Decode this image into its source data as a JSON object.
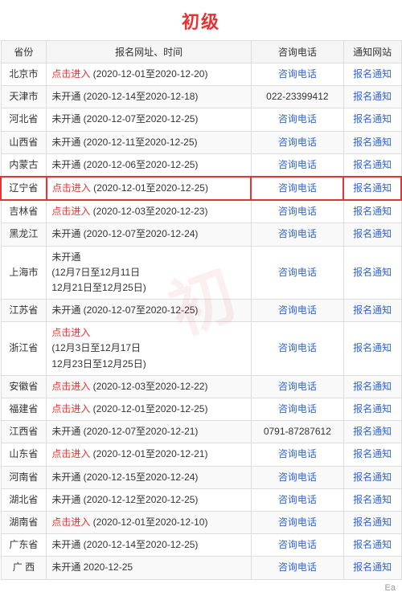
{
  "title": "初级",
  "watermark": "初",
  "footer_text": "Ea",
  "columns": [
    "省份",
    "报名网址、时间",
    "咨询电话",
    "通知网站"
  ],
  "rows": [
    {
      "province": "北京市",
      "registration": "点击进入  (2020-12-01至2020-12-20)",
      "registration_link": true,
      "phone": "",
      "phone_link": "咨询电话",
      "notice_link": "报名通知",
      "highlight": false
    },
    {
      "province": "天津市",
      "registration": "未开通  (2020-12-14至2020-12-18)",
      "registration_link": false,
      "phone": "022-23399412",
      "phone_link": "",
      "notice_link": "报名通知",
      "highlight": false
    },
    {
      "province": "河北省",
      "registration": "未开通  (2020-12-07至2020-12-25)",
      "registration_link": false,
      "phone": "",
      "phone_link": "咨询电话",
      "notice_link": "报名通知",
      "highlight": false
    },
    {
      "province": "山西省",
      "registration": "未开通  (2020-12-11至2020-12-25)",
      "registration_link": false,
      "phone": "",
      "phone_link": "咨询电话",
      "notice_link": "报名通知",
      "highlight": false
    },
    {
      "province": "内蒙古",
      "registration": "未开通  (2020-12-06至2020-12-25)",
      "registration_link": false,
      "phone": "",
      "phone_link": "咨询电话",
      "notice_link": "报名通知",
      "highlight": false
    },
    {
      "province": "辽宁省",
      "registration": "点击进入  (2020-12-01至2020-12-25)",
      "registration_link": true,
      "phone": "",
      "phone_link": "咨询电话",
      "notice_link": "报名通知",
      "highlight": true
    },
    {
      "province": "吉林省",
      "registration": "点击进入  (2020-12-03至2020-12-23)",
      "registration_link": true,
      "phone": "",
      "phone_link": "咨询电话",
      "notice_link": "报名通知",
      "highlight": false
    },
    {
      "province": "黑龙江",
      "registration": "未开通  (2020-12-07至2020-12-24)",
      "registration_link": false,
      "phone": "",
      "phone_link": "咨询电话",
      "notice_link": "报名通知",
      "highlight": false
    },
    {
      "province": "上海市",
      "registration": "未开通\n(12月7日至12月11日\n12月21日至12月25日)",
      "registration_link": false,
      "phone": "",
      "phone_link": "咨询电话",
      "notice_link": "报名通知",
      "highlight": false
    },
    {
      "province": "江苏省",
      "registration": "未开通  (2020-12-07至2020-12-25)",
      "registration_link": false,
      "phone": "",
      "phone_link": "咨询电话",
      "notice_link": "报名通知",
      "highlight": false
    },
    {
      "province": "浙江省",
      "registration": "点击进入\n(12月3日至12月17日\n12月23日至12月25日)",
      "registration_link": true,
      "phone": "",
      "phone_link": "咨询电话",
      "notice_link": "报名通知",
      "highlight": false
    },
    {
      "province": "安徽省",
      "registration": "点击进入  (2020-12-03至2020-12-22)",
      "registration_link": true,
      "phone": "",
      "phone_link": "咨询电话",
      "notice_link": "报名通知",
      "highlight": false
    },
    {
      "province": "福建省",
      "registration": "点击进入  (2020-12-01至2020-12-25)",
      "registration_link": true,
      "phone": "",
      "phone_link": "咨询电话",
      "notice_link": "报名通知",
      "highlight": false
    },
    {
      "province": "江西省",
      "registration": "未开通  (2020-12-07至2020-12-21)",
      "registration_link": false,
      "phone": "0791-87287612",
      "phone_link": "",
      "notice_link": "报名通知",
      "highlight": false
    },
    {
      "province": "山东省",
      "registration": "点击进入  (2020-12-01至2020-12-21)",
      "registration_link": true,
      "phone": "",
      "phone_link": "咨询电话",
      "notice_link": "报名通知",
      "highlight": false
    },
    {
      "province": "河南省",
      "registration": "未开通  (2020-12-15至2020-12-24)",
      "registration_link": false,
      "phone": "",
      "phone_link": "咨询电话",
      "notice_link": "报名通知",
      "highlight": false
    },
    {
      "province": "湖北省",
      "registration": "未开通  (2020-12-12至2020-12-25)",
      "registration_link": false,
      "phone": "",
      "phone_link": "咨询电话",
      "notice_link": "报名通知",
      "highlight": false
    },
    {
      "province": "湖南省",
      "registration": "点击进入  (2020-12-01至2020-12-10)",
      "registration_link": true,
      "phone": "",
      "phone_link": "咨询电话",
      "notice_link": "报名通知",
      "highlight": false
    },
    {
      "province": "广东省",
      "registration": "未开通  (2020-12-14至2020-12-25)",
      "registration_link": false,
      "phone": "",
      "phone_link": "咨询电话",
      "notice_link": "报名通知",
      "highlight": false
    },
    {
      "province": "广 西",
      "registration": "未开通  2020-12-25",
      "registration_link": false,
      "phone": "",
      "phone_link": "咨询电话",
      "notice_link": "报名通知",
      "highlight": false
    }
  ]
}
